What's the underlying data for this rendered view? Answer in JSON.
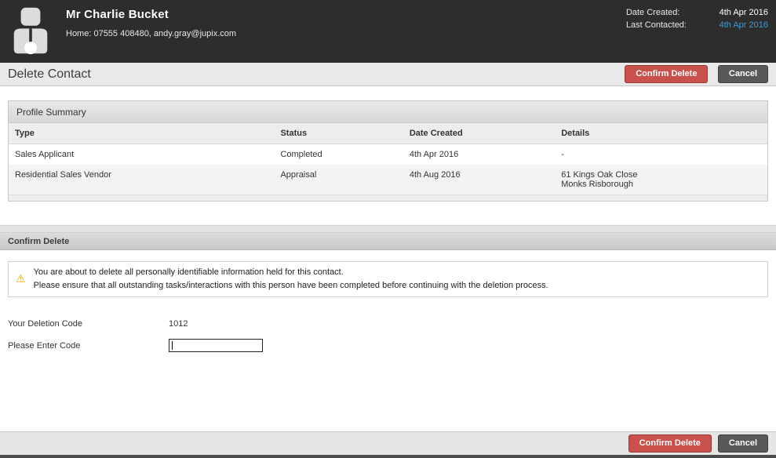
{
  "header": {
    "name": "Mr Charlie Bucket",
    "contact_info": "Home: 07555 408480, andy.gray@jupix.com",
    "date_created_label": "Date Created:",
    "date_created_value": "4th Apr 2016",
    "last_contacted_label": "Last Contacted:",
    "last_contacted_value": "4th Apr 2016"
  },
  "page": {
    "title": "Delete Contact",
    "confirm_delete_label": "Confirm Delete",
    "cancel_label": "Cancel"
  },
  "profile_summary": {
    "title": "Profile Summary",
    "columns": [
      "Type",
      "Status",
      "Date Created",
      "Details"
    ],
    "rows": [
      {
        "type": "Sales Applicant",
        "status": "Completed",
        "date_created": "4th Apr 2016",
        "details": "-",
        "details_line2": ""
      },
      {
        "type": "Residential Sales Vendor",
        "status": "Appraisal",
        "date_created": "4th Aug 2016",
        "details": "61 Kings Oak Close",
        "details_line2": "Monks Risborough"
      }
    ]
  },
  "confirm_delete": {
    "title": "Confirm Delete",
    "warning_line1": "You are about to delete all personally identifiable information held for this contact.",
    "warning_line2": "Please ensure that all outstanding tasks/interactions with this person have been completed before continuing with the deletion process.",
    "deletion_code_label": "Your Deletion Code",
    "deletion_code_value": "1012",
    "enter_code_label": "Please Enter Code",
    "enter_code_value": ""
  },
  "footer": {
    "confirm_delete_label": "Confirm Delete",
    "cancel_label": "Cancel"
  },
  "icons": {
    "warning": "⚠"
  },
  "colors": {
    "header_bg": "#2d2d2d",
    "accent_red": "#c9504b",
    "button_gray": "#58585a",
    "link_blue": "#3d9bd5"
  }
}
